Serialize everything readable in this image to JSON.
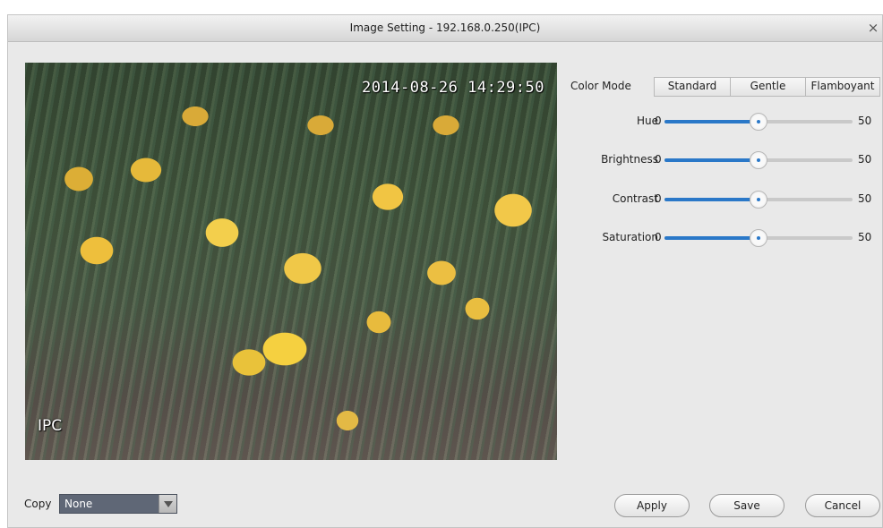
{
  "dialog": {
    "title": "Image Setting - 192.168.0.250(IPC)",
    "close_glyph": "×"
  },
  "preview": {
    "timestamp": "2014-08-26 14:29:50",
    "channel_label": "IPC"
  },
  "color_mode": {
    "label": "Color Mode",
    "options": [
      "Standard",
      "Gentle",
      "Flamboyant"
    ]
  },
  "sliders": [
    {
      "label": "Hue",
      "min": "0",
      "max": "50",
      "value_fraction": 0.5
    },
    {
      "label": "Brightness",
      "min": "0",
      "max": "50",
      "value_fraction": 0.5
    },
    {
      "label": "Contrast",
      "min": "0",
      "max": "50",
      "value_fraction": 0.5
    },
    {
      "label": "Saturation",
      "min": "0",
      "max": "50",
      "value_fraction": 0.5
    }
  ],
  "copy": {
    "label": "Copy",
    "selected": "None"
  },
  "buttons": {
    "apply": "Apply",
    "save": "Save",
    "cancel": "Cancel"
  },
  "colors": {
    "accent": "#2a78c8",
    "select_bg": "#5f6776"
  }
}
